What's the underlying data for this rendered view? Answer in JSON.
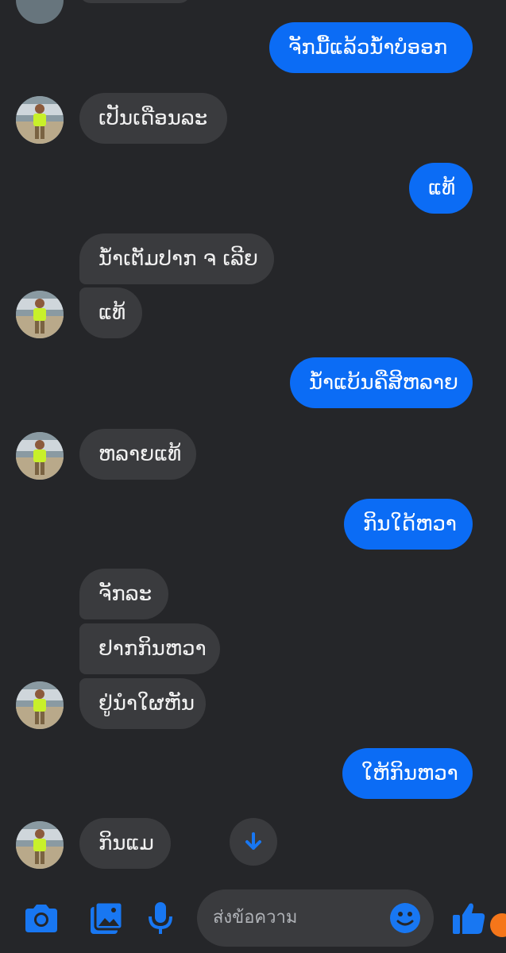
{
  "messages": [
    {
      "dir": "out",
      "text": "ຈັກມື້ແລ້ວນໍ້າບໍອອກ"
    },
    {
      "dir": "in",
      "text": "ເປັນເດືອນລະ"
    },
    {
      "dir": "out",
      "text": "ແທ້"
    },
    {
      "dir": "in",
      "text": "ນໍ້າເຕັມປາກ ຈ ເລີຍ"
    },
    {
      "dir": "in",
      "text": "ແທ້"
    },
    {
      "dir": "out",
      "text": "ນໍ້າແບ້ນຄືສິຫລາຍ"
    },
    {
      "dir": "in",
      "text": "ຫລາຍແທ້"
    },
    {
      "dir": "out",
      "text": "ກິນໃດ້ຫວາ"
    },
    {
      "dir": "in",
      "text": "ຈັກລະ"
    },
    {
      "dir": "in",
      "text": "ຢາກກິນຫວາ"
    },
    {
      "dir": "in",
      "text": "ຢູ່ນຳໃຜຫັນ"
    },
    {
      "dir": "out",
      "text": "ໃຫ້ກິນຫວາ"
    },
    {
      "dir": "in",
      "text": "ກິນແມ"
    }
  ],
  "composer": {
    "placeholder": "ส่งข้อความ",
    "icons": [
      "camera-icon",
      "gallery-icon",
      "microphone-icon",
      "emoji-icon",
      "like-icon"
    ]
  },
  "scroll_down_icon": "arrow-down-icon",
  "colors": {
    "background": "#252629",
    "outgoing_bubble": "#0b6cf5",
    "incoming_bubble": "#3a3b3e",
    "accent": "#1877f2"
  }
}
